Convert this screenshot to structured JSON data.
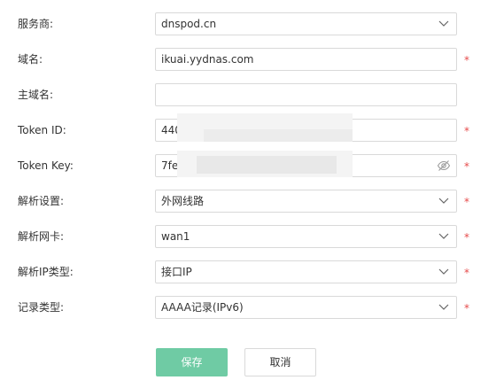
{
  "form": {
    "provider": {
      "label": "服务商:",
      "value": "dnspod.cn",
      "required": false
    },
    "domain": {
      "label": "域名:",
      "value": "ikuai.yydnas.com",
      "required": true
    },
    "main_domain": {
      "label": "主域名:",
      "value": "",
      "required": false
    },
    "token_id": {
      "label": "Token ID:",
      "value": "440",
      "required": true
    },
    "token_key": {
      "label": "Token Key:",
      "value": "7fe",
      "required": true
    },
    "resolve_setting": {
      "label": "解析设置:",
      "value": "外网线路",
      "required": true
    },
    "resolve_nic": {
      "label": "解析网卡:",
      "value": "wan1",
      "required": true
    },
    "resolve_ip_type": {
      "label": "解析IP类型:",
      "value": "接口IP",
      "required": true
    },
    "record_type": {
      "label": "记录类型:",
      "value": "AAAA记录(IPv6)",
      "required": true
    }
  },
  "required_mark": "*",
  "buttons": {
    "save": "保存",
    "cancel": "取消"
  },
  "colors": {
    "accent": "#6fcba4",
    "required": "#e64b4b",
    "border": "#d9d9d9"
  },
  "icons": {
    "select": "chevron-down-icon",
    "password": "eye-off-icon"
  }
}
